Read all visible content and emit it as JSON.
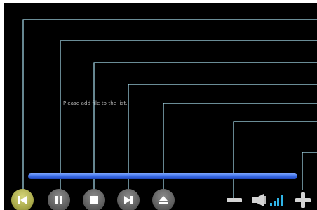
{
  "playlist": {
    "empty_message": "Please add file to the list."
  },
  "progress": {
    "fraction": 1.0
  },
  "controls": {
    "previous": {
      "icon": "skip-previous-icon",
      "active": true
    },
    "pause": {
      "icon": "pause-icon",
      "active": false
    },
    "stop": {
      "icon": "stop-icon",
      "active": false
    },
    "next": {
      "icon": "skip-next-icon",
      "active": false
    },
    "eject": {
      "icon": "eject-icon",
      "active": false
    }
  },
  "volume": {
    "decrease_icon": "minus-icon",
    "speaker_icon": "speaker-icon",
    "level_icon": "volume-level-icon",
    "increase_icon": "plus-icon",
    "level_bars_lit": 4,
    "level_bars_total": 4
  },
  "colors": {
    "background": "#000000",
    "callout_line": "#a9dff0",
    "progress_fill": "#3c6eea",
    "active_button": "#a9a94a",
    "button": "#5f5f5f",
    "volume_level": "#2fb4e6"
  }
}
